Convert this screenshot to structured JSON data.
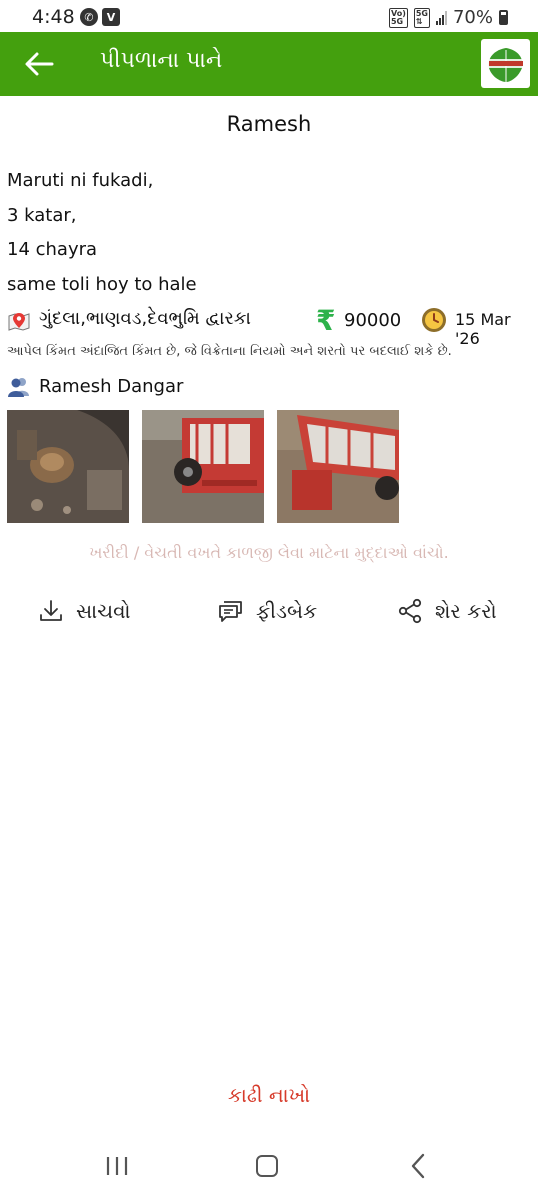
{
  "status_bar": {
    "time": "4:48",
    "battery": "70%",
    "icons": [
      "whatsapp-icon",
      "vpn-icon",
      "volte-icon",
      "5g-icon",
      "signal-icon",
      "battery-icon"
    ]
  },
  "app_bar": {
    "title": "પીપળાના પાને",
    "back_icon": "arrow-left-icon",
    "logo_icon": "app-logo-icon",
    "color": "#44a00e"
  },
  "listing": {
    "heading": "Ramesh",
    "description_lines": [
      "Maruti ni fukadi,",
      "3 katar,",
      "14 chayra",
      "same toli hoy to hale"
    ],
    "location": "ગુંદલા,ભાણવડ,દેવભુમિ દ્વારકા",
    "currency_symbol": "₹",
    "price": "90000",
    "date": "15 Mar '26",
    "disclaimer": "આપેલ કિંમત અંદાજિત કિંમત છે, જે વિક્રેતાના નિયમો અને શરતો પર બદલાઈ શકે છે.",
    "seller_name": "Ramesh Dangar",
    "images": [
      "machine-photo-1",
      "machine-photo-2",
      "machine-photo-3"
    ]
  },
  "tips_link": "ખરીદી / વેચતી વખતે કાળજી લેવા માટેના મુદ્દાઓ વાંચો.",
  "actions": {
    "save": "સાચવો",
    "feedback": "ફીડબેક",
    "share": "શેર કરો"
  },
  "remove_label": "કાઢી નાખો",
  "colors": {
    "green_bar": "#44a00e",
    "rupee": "#2db24a",
    "remove": "#d63a2a",
    "tips": "#d8b8b4"
  }
}
